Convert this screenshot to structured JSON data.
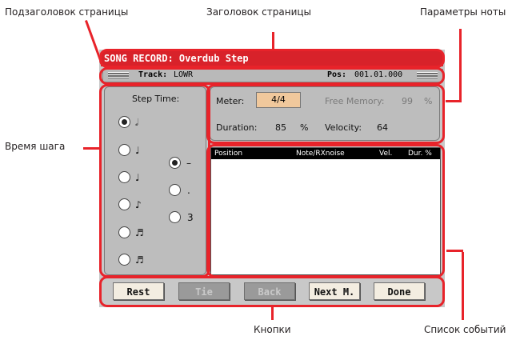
{
  "annotations": {
    "page_subtitle": "Подзаголовок страницы",
    "page_title": "Заголовок страницы",
    "note_params": "Параметры ноты",
    "step_time": "Время шага",
    "buttons": "Кнопки",
    "event_list": "Список событий"
  },
  "screen": {
    "title": "SONG RECORD: Overdub Step",
    "track_label": "Track:",
    "track_value": "LOWR",
    "pos_label": "Pos:",
    "pos_value": "001.01.000",
    "step_time_label": "Step Time:",
    "note_glyphs": [
      "𝅗𝅥",
      "♩",
      "♩",
      "♪",
      "♬",
      "♬"
    ],
    "modifier_glyphs": [
      "–",
      ".",
      "3"
    ],
    "meter_label": "Meter:",
    "meter_value": "4/4",
    "free_memory_label": "Free Memory:",
    "free_memory_value": "99",
    "free_memory_unit": "%",
    "duration_label": "Duration:",
    "duration_value": "85",
    "duration_unit": "%",
    "velocity_label": "Velocity:",
    "velocity_value": "64",
    "columns": [
      "Position",
      "Note/RXnoise",
      "Vel.",
      "Dur. %"
    ],
    "buttons": [
      "Rest",
      "Tie",
      "Back",
      "Next M.",
      "Done"
    ]
  }
}
